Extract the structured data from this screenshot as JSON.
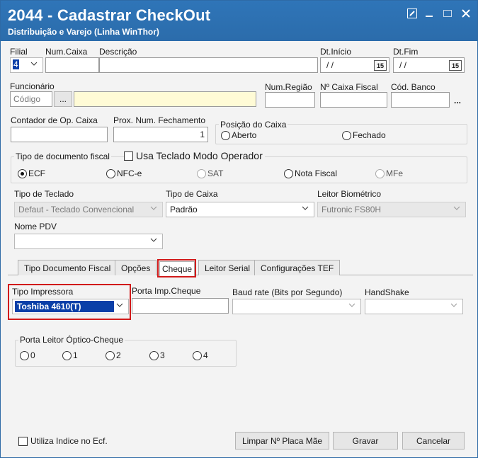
{
  "window": {
    "title": "2044 - Cadastrar CheckOut",
    "subtitle": "Distribuição e Varejo (Linha WinThor)"
  },
  "row1": {
    "filial_label": "Filial",
    "filial_value": "4",
    "num_caixa_label": "Num.Caixa",
    "descricao_label": "Descrição",
    "dt_inicio_label": "Dt.Início",
    "dt_inicio_value": "/ /",
    "dt_fim_label": "Dt.Fim",
    "dt_fim_value": "/ /",
    "cal_text": "15"
  },
  "row2": {
    "funcionario_label": "Funcionário",
    "codigo_placeholder": "Código",
    "ellipsis": "...",
    "num_regiao_label": "Num.Região",
    "caixa_fiscal_label": "Nº Caixa Fiscal",
    "cod_banco_label": "Cód. Banco"
  },
  "row3": {
    "contador_label": "Contador de Op. Caixa",
    "prox_label": "Prox. Num. Fechamento",
    "prox_value": "1",
    "posicao_label": "Posição do Caixa",
    "aberto": "Aberto",
    "fechado": "Fechado"
  },
  "doc_fiscal": {
    "label": "Tipo de documento fiscal",
    "teclado_check": "Usa Teclado Modo Operador",
    "options": [
      "ECF",
      "NFC-e",
      "SAT",
      "Nota Fiscal",
      "MFe"
    ]
  },
  "row5": {
    "tipo_teclado_label": "Tipo de Teclado",
    "tipo_teclado_value": "Defaut - Teclado Convencional",
    "tipo_caixa_label": "Tipo de Caixa",
    "tipo_caixa_value": "Padrão",
    "leitor_label": "Leitor Biométrico",
    "leitor_value": "Futronic FS80H",
    "nome_pdv_label": "Nome PDV"
  },
  "tabs": [
    "Tipo Documento Fiscal",
    "Opções",
    "Cheque",
    "Leitor Serial",
    "Configurações TEF"
  ],
  "cheque": {
    "tipo_impressora_label": "Tipo Impressora",
    "tipo_impressora_value": "Toshiba 4610(T)",
    "porta_label": "Porta Imp.Cheque",
    "baud_label": "Baud rate (Bits por Segundo)",
    "handshake_label": "HandShake",
    "porta_leitor_label": "Porta Leitor Óptico-Cheque",
    "porta_options": [
      "0",
      "1",
      "2",
      "3",
      "4"
    ]
  },
  "footer": {
    "utiliza_label": "Utiliza Indice no Ecf.",
    "limpar": "Limpar Nº Placa Mãe",
    "gravar": "Gravar",
    "cancelar": "Cancelar"
  },
  "colors": {
    "titlebar": "#2f75b8",
    "highlight": "#d11a1a",
    "selection": "#0a3fa8",
    "yellow_field": "#fffbd6"
  }
}
